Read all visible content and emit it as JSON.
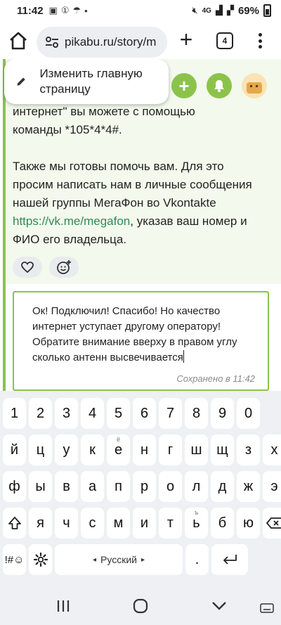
{
  "status_bar": {
    "time": "11:42",
    "battery": "69%",
    "network": "4G"
  },
  "browser": {
    "url": "pikabu.ru/story/m",
    "tab_count": "4"
  },
  "tooltip": {
    "label": "Изменить главную страницу"
  },
  "page": {
    "lines": [
      "интернет\" вы можете с помощью",
      "команды *105*4*4#.",
      "Также мы готовы помочь вам. Для это",
      "просим написать нам в личные сообщения",
      "нашей группы МегаФон во Vkontakte",
      ", указав ваш номер и",
      "ФИО его владельца."
    ],
    "link": "https://vk.me/megafon"
  },
  "editor": {
    "text": "Ок! Подключил! Спасибо! Но качество интернет уступает другому оператору! Обратите внимание вверху в правом углу сколько антенн высвечивается",
    "saved": "Сохранено в 11:42"
  },
  "keyboard": {
    "numbers": [
      "1",
      "2",
      "3",
      "4",
      "5",
      "6",
      "7",
      "8",
      "9",
      "0"
    ],
    "row1": [
      "й",
      "ц",
      "у",
      "к",
      "е",
      "н",
      "г",
      "ш",
      "щ",
      "з",
      "х"
    ],
    "row1_hint": "ё",
    "row2": [
      "ф",
      "ы",
      "в",
      "а",
      "п",
      "р",
      "о",
      "л",
      "д",
      "ж",
      "э"
    ],
    "row3": [
      "я",
      "ч",
      "с",
      "м",
      "и",
      "т",
      "ь",
      "б",
      "ю"
    ],
    "row3_hint": "ъ",
    "symbols": "!#☺",
    "space": "Русский",
    "dot": "."
  },
  "colors": {
    "accent": "#8bc34a",
    "link": "#2e8b57",
    "reply_bg": "#f3f9ec"
  }
}
